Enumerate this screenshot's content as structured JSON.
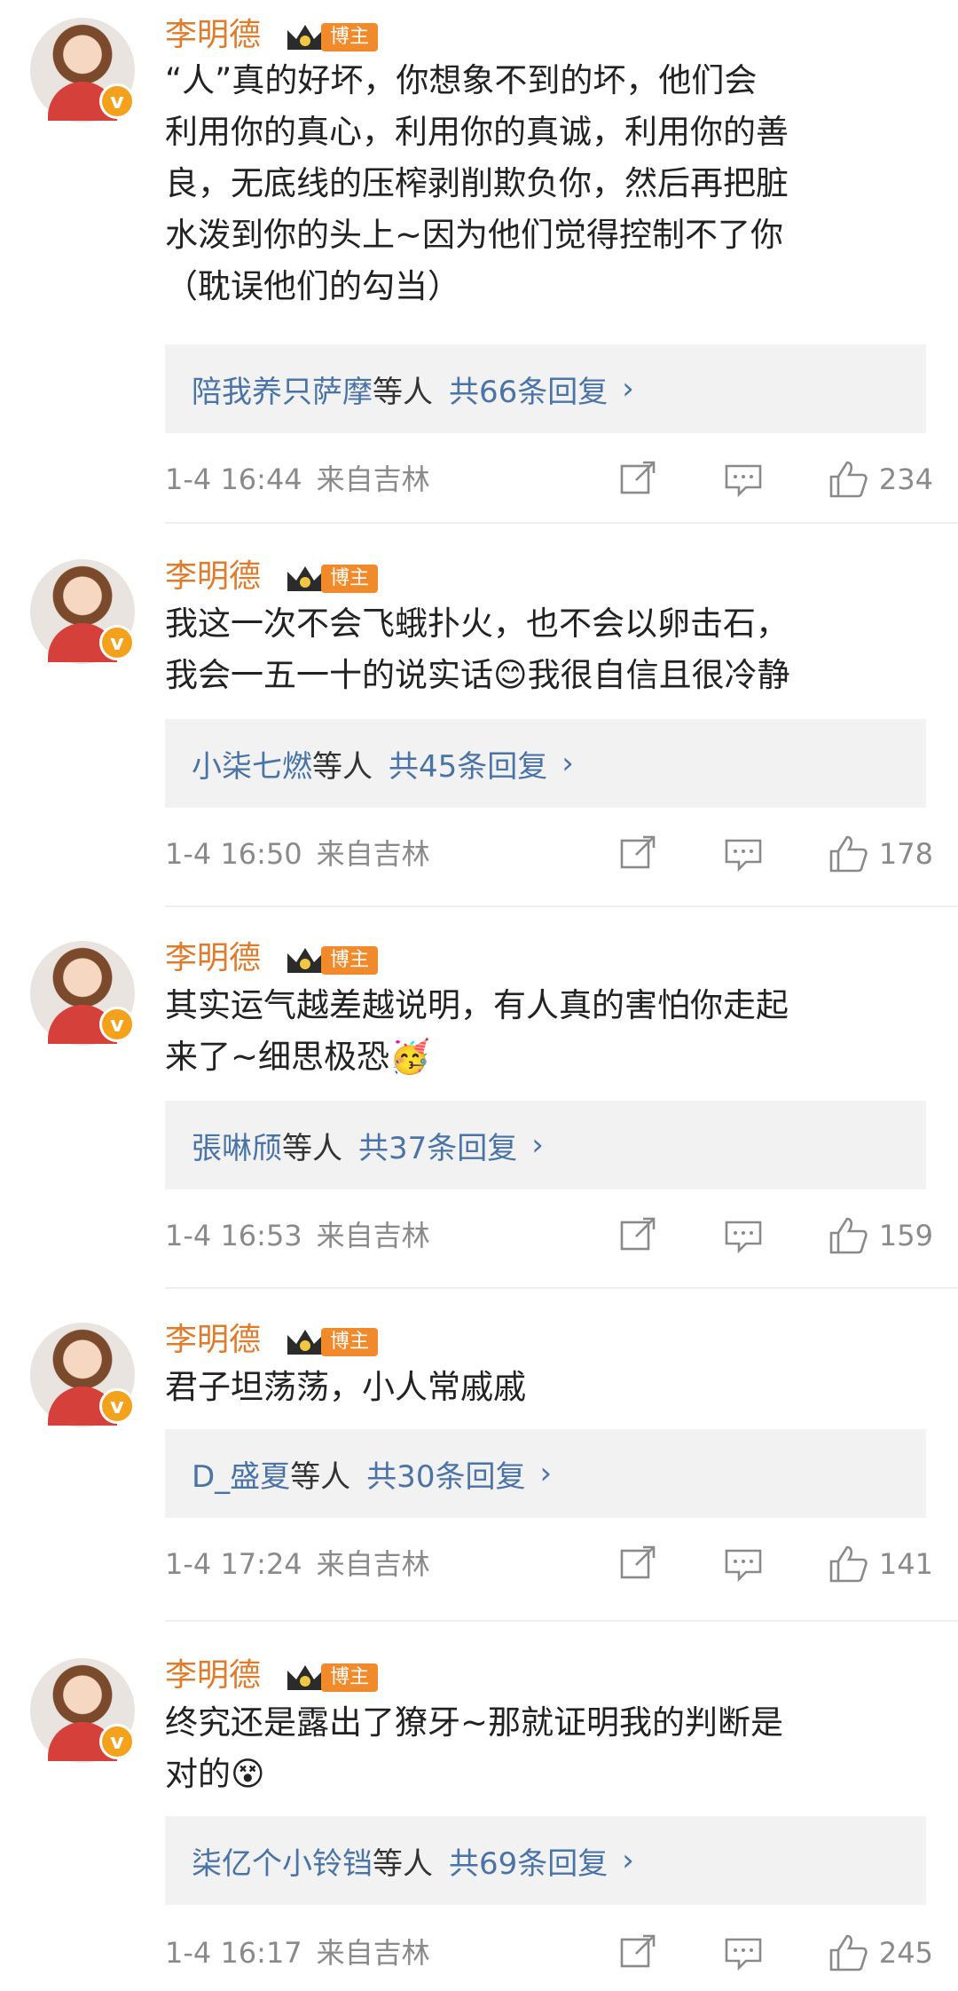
{
  "comments": [
    {
      "author": "李明德",
      "badge": "博主",
      "text": "“人”真的好坏，你想象不到的坏，他们会\n利用你的真心，利用你的真诚，利用你的善\n良，无底线的压榨剥削欺负你，然后再把脏\n水泼到你的头上~因为他们觉得控制不了你\n（耽误他们的勾当）",
      "reply_users": "陪我养只萨摩",
      "reply_et": "等人",
      "reply_count": "共66条回复",
      "time": "1-4 16:44",
      "from": "来自吉林",
      "likes": "234"
    },
    {
      "author": "李明德",
      "badge": "博主",
      "text": "我这一次不会飞蛾扑火，也不会以卵击石，\n我会一五一十的说实话😊我很自信且很冷静",
      "reply_users": "小柒七燃",
      "reply_et": "等人",
      "reply_count": "共45条回复",
      "time": "1-4 16:50",
      "from": "来自吉林",
      "likes": "178"
    },
    {
      "author": "李明德",
      "badge": "博主",
      "text": "其实运气越差越说明，有人真的害怕你走起\n来了~细思极恐🥳",
      "reply_users": "張啉颀",
      "reply_et": "等人",
      "reply_count": "共37条回复",
      "time": "1-4 16:53",
      "from": "来自吉林",
      "likes": "159"
    },
    {
      "author": "李明德",
      "badge": "博主",
      "text": "君子坦荡荡，小人常戚戚",
      "reply_users": "D_盛夏",
      "reply_et": "等人",
      "reply_count": "共30条回复",
      "time": "1-4 17:24",
      "from": "来自吉林",
      "likes": "141"
    },
    {
      "author": "李明德",
      "badge": "博主",
      "text": "终究还是露出了獠牙~那就证明我的判断是\n对的😵",
      "reply_users": "柒亿个小铃铛",
      "reply_et": "等人",
      "reply_count": "共69条回复",
      "time": "1-4 16:17",
      "from": "来自吉林",
      "likes": "245"
    }
  ],
  "icons": {
    "share": "share-icon",
    "comment": "comment-icon",
    "like": "thumbs-up-icon",
    "chevron": "›"
  },
  "colors": {
    "author": "#e07b2a",
    "badge_bg": "#f08a2b",
    "link": "#4a73a8",
    "meta": "#8a8a8a",
    "reply_bg": "#f2f2f2"
  }
}
